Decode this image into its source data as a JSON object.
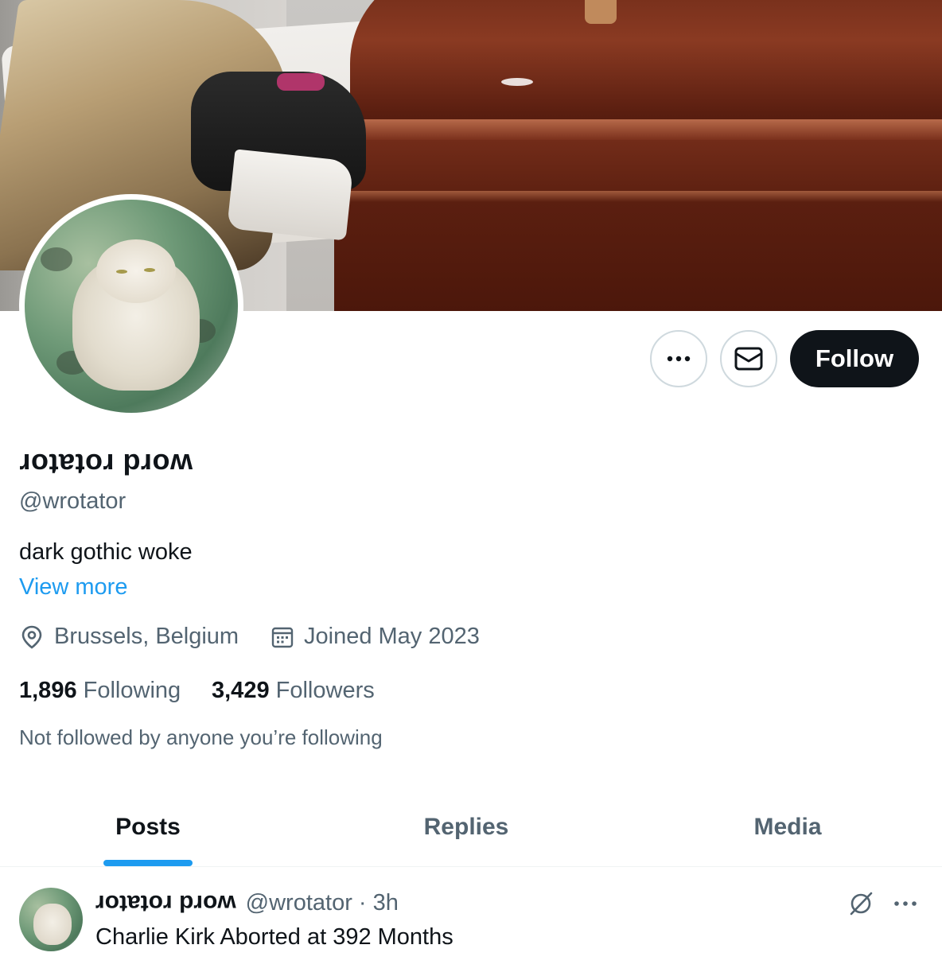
{
  "profile": {
    "display_name": "word rotator",
    "handle": "@wrotator",
    "bio": "dark gothic woke",
    "view_more": "View more",
    "location": "Brussels, Belgium",
    "joined": "Joined May 2023",
    "following_count": "1,896",
    "following_label": "Following",
    "followers_count": "3,429",
    "followers_label": "Followers",
    "not_followed_text": "Not followed by anyone you’re following"
  },
  "actions": {
    "more_icon": "more-horizontal-icon",
    "message_icon": "envelope-icon",
    "follow_label": "Follow"
  },
  "tabs": [
    {
      "label": "Posts",
      "active": true
    },
    {
      "label": "Replies",
      "active": false
    },
    {
      "label": "Media",
      "active": false
    }
  ],
  "post": {
    "display_name": "word rotator",
    "handle_time": "@wrotator · 3h",
    "text": "Charlie Kirk Aborted at 392 Months"
  },
  "colors": {
    "accent": "#1d9bf0",
    "text_primary": "#0f1419",
    "text_secondary": "#536471",
    "follow_bg": "#0f1419"
  }
}
